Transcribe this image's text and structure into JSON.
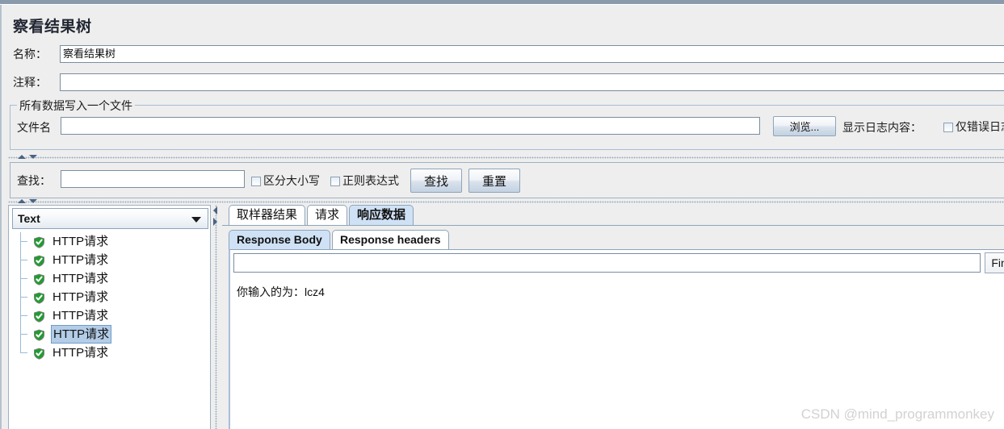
{
  "window": {
    "title": "察看结果树"
  },
  "form": {
    "name_label": "名称：",
    "name_value": "察看结果树",
    "comment_label": "注释：",
    "comment_value": "",
    "group_title": "所有数据写入一个文件",
    "file_label": "文件名",
    "file_value": "",
    "browse_button": "浏览...",
    "log_display_label": "显示日志内容：",
    "error_only_label": "仅错误日志"
  },
  "search": {
    "label": "查找：",
    "value": "",
    "case_sensitive_label": "区分大小写",
    "regex_label": "正则表达式",
    "find_button": "查找",
    "reset_button": "重置"
  },
  "tree": {
    "renderer_selected": "Text",
    "nodes": [
      {
        "label": "HTTP请求",
        "status": "success",
        "selected": false
      },
      {
        "label": "HTTP请求",
        "status": "success",
        "selected": false
      },
      {
        "label": "HTTP请求",
        "status": "success",
        "selected": false
      },
      {
        "label": "HTTP请求",
        "status": "success",
        "selected": false
      },
      {
        "label": "HTTP请求",
        "status": "success",
        "selected": false
      },
      {
        "label": "HTTP请求",
        "status": "success",
        "selected": true
      },
      {
        "label": "HTTP请求",
        "status": "success",
        "selected": false
      }
    ]
  },
  "tabs": [
    {
      "label": "取样器结果",
      "active": false
    },
    {
      "label": "请求",
      "active": false
    },
    {
      "label": "响应数据",
      "active": true
    }
  ],
  "subtabs": [
    {
      "label": "Response Body",
      "active": true
    },
    {
      "label": "Response headers",
      "active": false
    }
  ],
  "response": {
    "search_value": "",
    "find_button": "Find",
    "body_text": "你输入的为：lcz4"
  },
  "watermark": "CSDN @mind_programmonkey",
  "colors": {
    "accent_tab": "#cfe1f5",
    "selection": "#b3cde8",
    "titlebar": "#8a9aab",
    "status_success": "#1f9d2f"
  }
}
